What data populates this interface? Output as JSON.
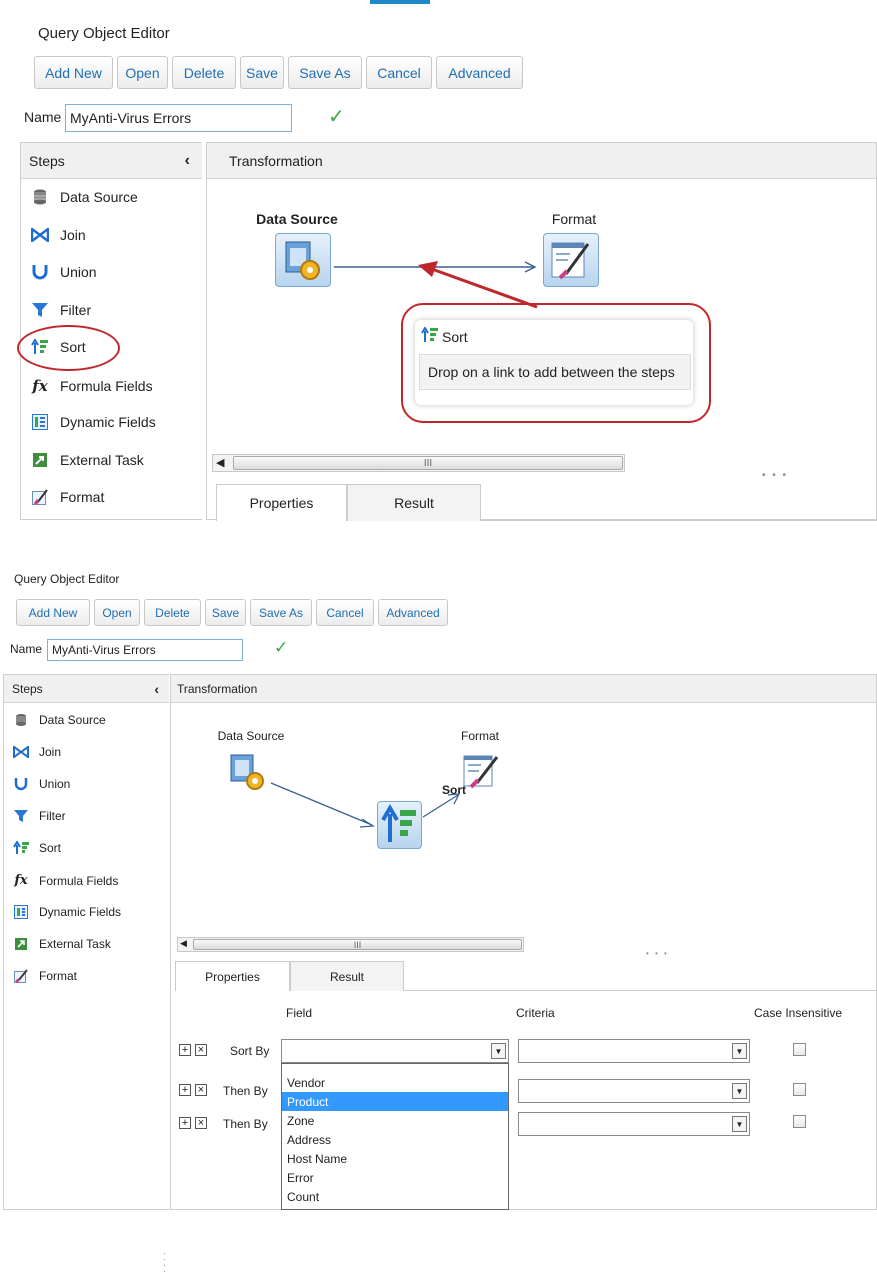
{
  "panel_top": {
    "title": "Query Object Editor",
    "toolbar": [
      "Add New",
      "Open",
      "Delete",
      "Save",
      "Save As",
      "Cancel",
      "Advanced"
    ],
    "name_label": "Name",
    "name_value": "MyAnti-Virus Errors",
    "steps_header": "Steps",
    "steps": [
      "Data Source",
      "Join",
      "Union",
      "Filter",
      "Sort",
      "Formula Fields",
      "Dynamic Fields",
      "External Task",
      "Format"
    ],
    "transformation_header": "Transformation",
    "nodes": {
      "data_source": "Data Source",
      "format": "Format"
    },
    "tooltip": {
      "title": "Sort",
      "message": "Drop on a link to add between the steps"
    },
    "scroll_thumb": "III",
    "tabs": [
      "Properties",
      "Result"
    ]
  },
  "panel_bottom": {
    "title": "Query Object Editor",
    "toolbar": [
      "Add New",
      "Open",
      "Delete",
      "Save",
      "Save As",
      "Cancel",
      "Advanced"
    ],
    "name_label": "Name",
    "name_value": "MyAnti-Virus Errors",
    "steps_header": "Steps",
    "steps": [
      "Data Source",
      "Join",
      "Union",
      "Filter",
      "Sort",
      "Formula Fields",
      "Dynamic Fields",
      "External Task",
      "Format"
    ],
    "transformation_header": "Transformation",
    "nodes": {
      "data_source": "Data Source",
      "sort": "Sort",
      "format": "Format"
    },
    "scroll_thumb": "III",
    "tabs": [
      "Properties",
      "Result"
    ],
    "properties": {
      "col_field": "Field",
      "col_criteria": "Criteria",
      "col_case": "Case Insensitive",
      "rows": [
        "Sort By",
        "Then By",
        "Then By"
      ],
      "dropdown_options": [
        "Vendor",
        "Product",
        "Zone",
        "Address",
        "Host Name",
        "Error",
        "Count"
      ],
      "dropdown_selected": "Product"
    }
  },
  "colors": {
    "accent": "#1e88c8",
    "link_blue": "#1f6fb2",
    "highlight_red": "#c0272d",
    "check_green": "#3aa64a",
    "selected": "#3399ff"
  }
}
